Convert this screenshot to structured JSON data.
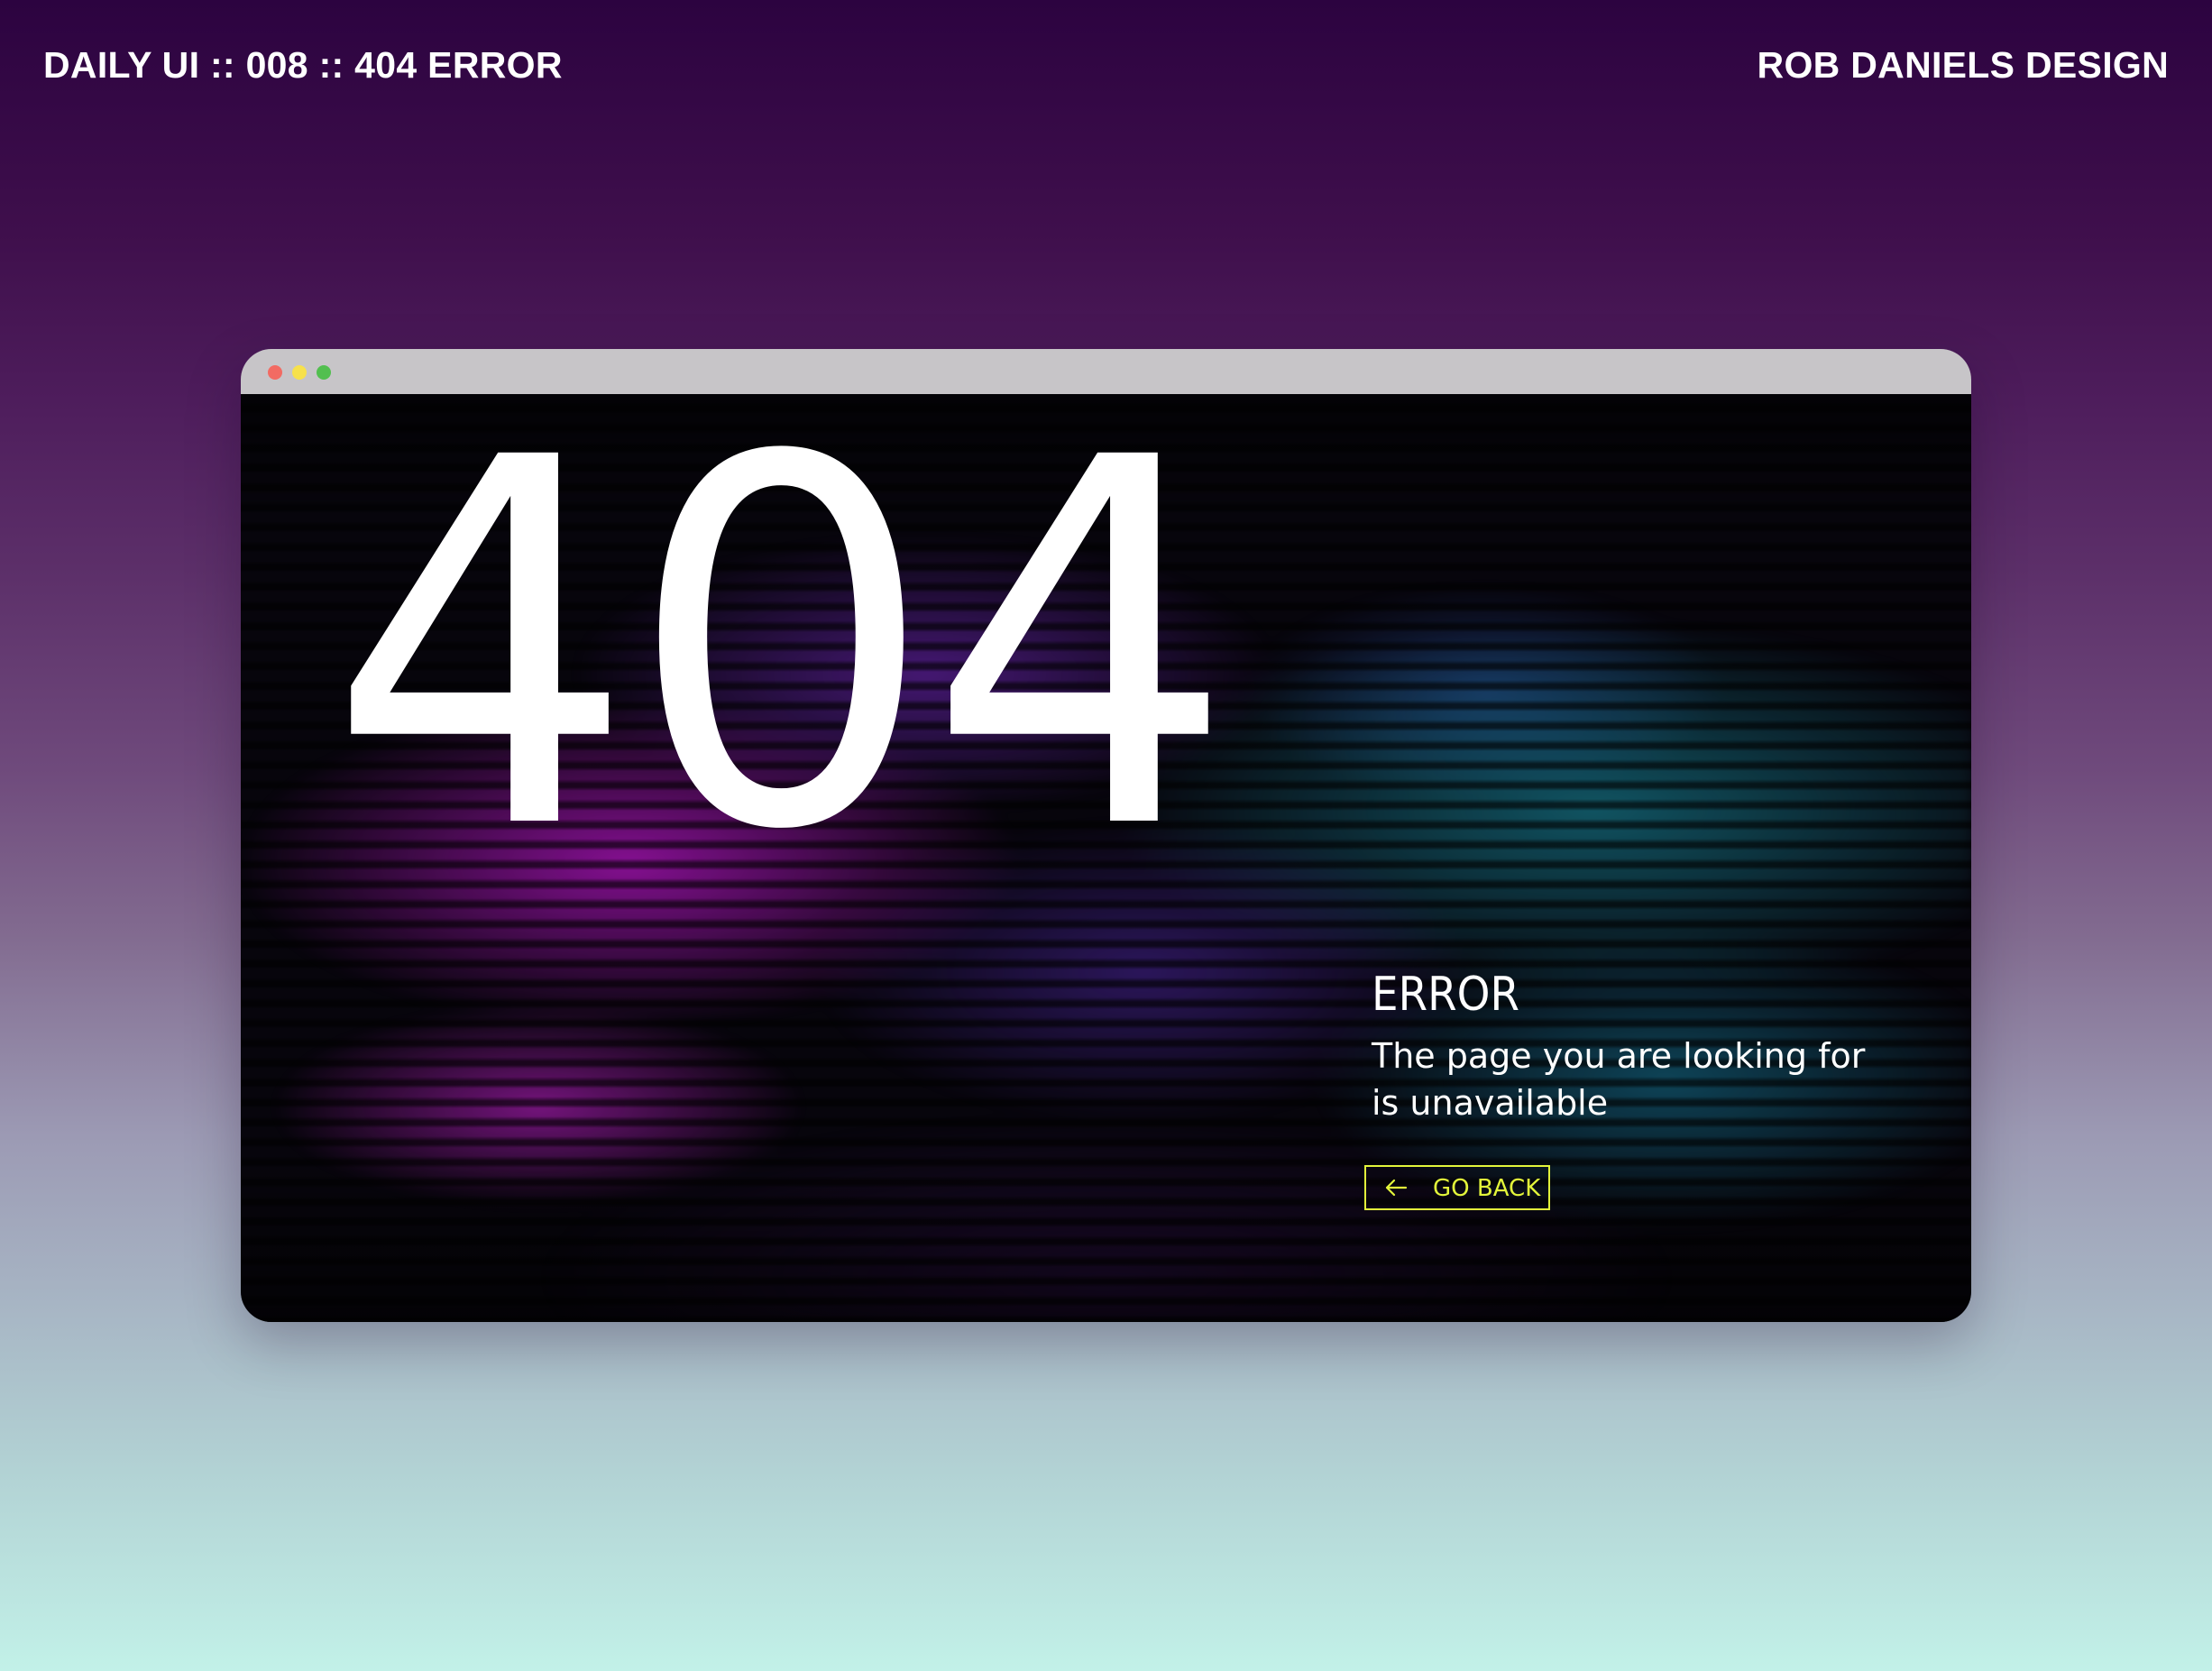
{
  "header": {
    "title": "DAILY UI :: 008 :: 404 ERROR",
    "credit": "ROB DANIELS DESIGN"
  },
  "browser_window": {
    "controls": [
      "close-dot",
      "minimize-dot",
      "maximize-dot"
    ],
    "control_colors": [
      "#f26b63",
      "#f7e14b",
      "#52bf4f"
    ]
  },
  "error_page": {
    "code": "404",
    "title": "ERROR",
    "message": "The page you are looking for is unavailable",
    "back_button": {
      "label": "GO BACK",
      "icon": "arrow-left-icon",
      "color": "#e3f53a"
    }
  },
  "colors": {
    "background_top": "#2c0340",
    "background_bottom": "#c2f1e8",
    "accent": "#e3f53a",
    "text": "#ffffff"
  }
}
